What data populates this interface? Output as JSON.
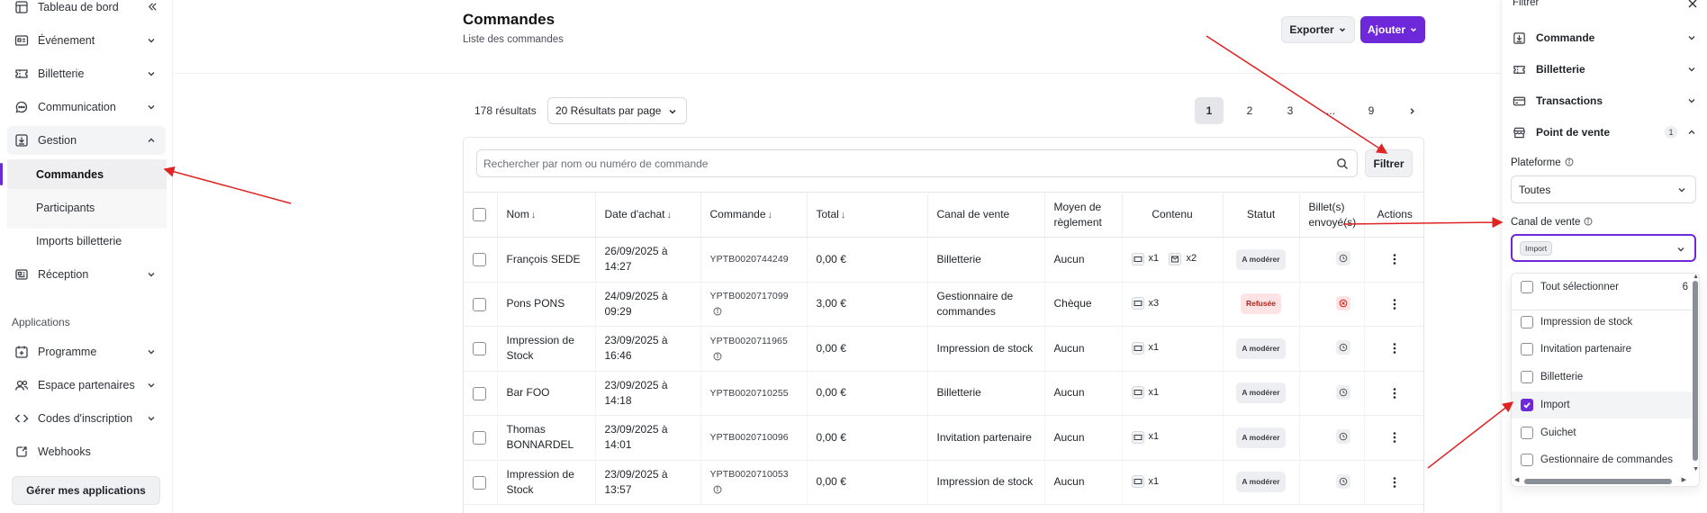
{
  "sidebar": {
    "items": [
      {
        "label": "Tableau de bord"
      },
      {
        "label": "Événement"
      },
      {
        "label": "Billetterie"
      },
      {
        "label": "Communication"
      },
      {
        "label": "Gestion"
      },
      {
        "label": "Réception"
      }
    ],
    "sub_items": [
      {
        "label": "Commandes"
      },
      {
        "label": "Participants"
      },
      {
        "label": "Imports billetterie"
      }
    ],
    "apps_section": "Applications",
    "app_items": [
      {
        "label": "Programme"
      },
      {
        "label": "Espace partenaires"
      },
      {
        "label": "Codes d'inscription"
      },
      {
        "label": "Webhooks"
      }
    ],
    "manage_apps_button": "Gérer mes applications"
  },
  "header": {
    "title": "Commandes",
    "subtitle": "Liste des commandes",
    "export_label": "Exporter",
    "add_label": "Ajouter"
  },
  "toolbar": {
    "results": "178 résultats",
    "per_page": "20 Résultats par page",
    "pages": [
      "1",
      "2",
      "3",
      "...",
      "9"
    ],
    "search_placeholder": "Rechercher par nom ou numéro de commande",
    "filter_label": "Filtrer"
  },
  "table": {
    "headers": {
      "name": "Nom",
      "date": "Date d'achat",
      "order": "Commande",
      "total": "Total",
      "channel": "Canal de vente",
      "payment": "Moyen de règlement",
      "content": "Contenu",
      "status": "Statut",
      "sent": "Billet(s) envoyé(s)",
      "actions": "Actions"
    },
    "rows": [
      {
        "name": "François SEDE",
        "date": "26/09/2025 à 14:27",
        "order": "YPTB0020744249",
        "total": "0,00 €",
        "channel": "Billetterie",
        "payment": "Aucun",
        "qty1": "x1",
        "qty2": "x2",
        "status": "A modérer"
      },
      {
        "name": "Pons PONS",
        "date": "24/09/2025 à 09:29",
        "order": "YPTB0020717099",
        "total": "3,00 €",
        "channel": "Gestionnaire de commandes",
        "payment": "Chèque",
        "qty1": "x3",
        "status": "Refusée"
      },
      {
        "name": "Impression de Stock",
        "date": "23/09/2025 à 16:46",
        "order": "YPTB0020711965",
        "total": "0,00 €",
        "channel": "Impression de stock",
        "payment": "Aucun",
        "qty1": "x1",
        "status": "A modérer"
      },
      {
        "name": "Bar FOO",
        "date": "23/09/2025 à 14:18",
        "order": "YPTB0020710255",
        "total": "0,00 €",
        "channel": "Billetterie",
        "payment": "Aucun",
        "qty1": "x1",
        "status": "A modérer"
      },
      {
        "name": "Thomas BONNARDEL",
        "date": "23/09/2025 à 14:01",
        "order": "YPTB0020710096",
        "total": "0,00 €",
        "channel": "Invitation partenaire",
        "payment": "Aucun",
        "qty1": "x1",
        "status": "A modérer"
      },
      {
        "name": "Impression de Stock",
        "date": "23/09/2025 à 13:57",
        "order": "YPTB0020710053",
        "total": "0,00 €",
        "channel": "Impression de stock",
        "payment": "Aucun",
        "qty1": "x1",
        "status": "A modérer"
      }
    ]
  },
  "filter_panel": {
    "title": "Filtrer",
    "sections": [
      "Commande",
      "Billetterie",
      "Transactions",
      "Point de vente"
    ],
    "point_de_vente_count": "1",
    "platform_label": "Plateforme",
    "platform_value": "Toutes",
    "channel_label": "Canal de vente",
    "channel_tag": "Import",
    "select_all": "Tout sélectionner",
    "select_all_count": "6",
    "options": [
      {
        "label": "Impression de stock",
        "checked": false
      },
      {
        "label": "Invitation partenaire",
        "checked": false
      },
      {
        "label": "Billetterie",
        "checked": false
      },
      {
        "label": "Import",
        "checked": true
      },
      {
        "label": "Guichet",
        "checked": false
      },
      {
        "label": "Gestionnaire de commandes",
        "checked": false
      }
    ]
  },
  "colors": {
    "accent": "#6d28d9",
    "annotation": "#e02424",
    "refused_bg": "#fde3e3",
    "refused_text": "#b42318"
  }
}
